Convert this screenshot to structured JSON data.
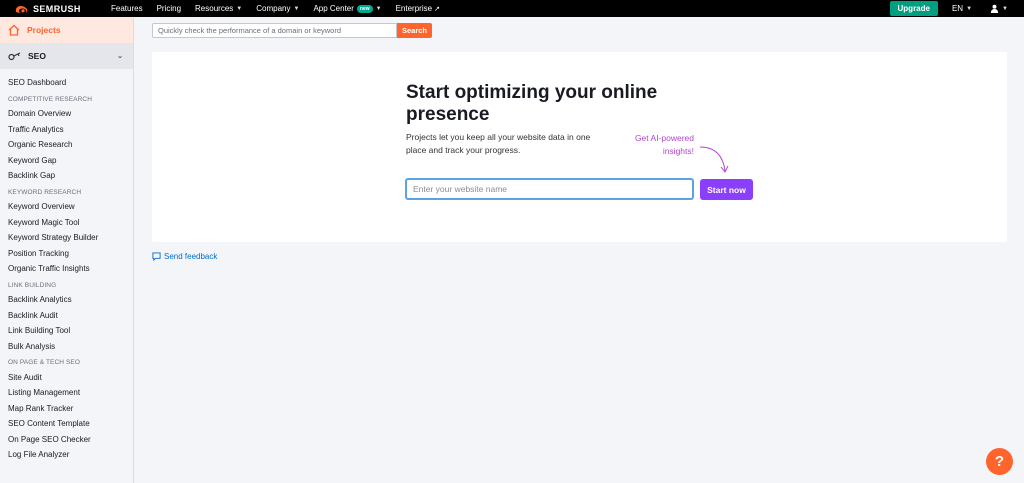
{
  "topbar": {
    "logo": "SEMRUSH",
    "nav": [
      {
        "label": "Features",
        "has_chevron": false
      },
      {
        "label": "Pricing",
        "has_chevron": false
      },
      {
        "label": "Resources",
        "has_chevron": true
      },
      {
        "label": "Company",
        "has_chevron": true
      },
      {
        "label": "App Center",
        "badge": "new",
        "has_chevron": true
      },
      {
        "label": "Enterprise",
        "external": true
      }
    ],
    "upgrade_label": "Upgrade",
    "language": "EN"
  },
  "sidebar": {
    "projects_label": "Projects",
    "seo_label": "SEO",
    "items": [
      {
        "type": "item",
        "label": "SEO Dashboard"
      },
      {
        "type": "head",
        "label": "COMPETITIVE RESEARCH"
      },
      {
        "type": "item",
        "label": "Domain Overview"
      },
      {
        "type": "item",
        "label": "Traffic Analytics"
      },
      {
        "type": "item",
        "label": "Organic Research"
      },
      {
        "type": "item",
        "label": "Keyword Gap"
      },
      {
        "type": "item",
        "label": "Backlink Gap"
      },
      {
        "type": "head",
        "label": "KEYWORD RESEARCH"
      },
      {
        "type": "item",
        "label": "Keyword Overview"
      },
      {
        "type": "item",
        "label": "Keyword Magic Tool"
      },
      {
        "type": "item",
        "label": "Keyword Strategy Builder"
      },
      {
        "type": "item",
        "label": "Position Tracking"
      },
      {
        "type": "item",
        "label": "Organic Traffic Insights"
      },
      {
        "type": "head",
        "label": "LINK BUILDING"
      },
      {
        "type": "item",
        "label": "Backlink Analytics"
      },
      {
        "type": "item",
        "label": "Backlink Audit"
      },
      {
        "type": "item",
        "label": "Link Building Tool"
      },
      {
        "type": "item",
        "label": "Bulk Analysis"
      },
      {
        "type": "head",
        "label": "ON PAGE & TECH SEO"
      },
      {
        "type": "item",
        "label": "Site Audit"
      },
      {
        "type": "item",
        "label": "Listing Management"
      },
      {
        "type": "item",
        "label": "Map Rank Tracker"
      },
      {
        "type": "item",
        "label": "SEO Content Template"
      },
      {
        "type": "item",
        "label": "On Page SEO Checker"
      },
      {
        "type": "item",
        "label": "Log File Analyzer"
      }
    ]
  },
  "search": {
    "placeholder": "Quickly check the performance of a domain or keyword",
    "button_label": "Search"
  },
  "main": {
    "headline": "Start optimizing your online presence",
    "description": "Projects let you keep all your website data in one place and track your progress.",
    "ai_note": "Get AI-powered insights!",
    "input_placeholder": "Enter your website name",
    "start_label": "Start now"
  },
  "feedback_label": "Send feedback",
  "help_label": "?",
  "colors": {
    "brand_orange": "#ff642d",
    "upgrade_green": "#009f81",
    "start_purple": "#8a3ffc",
    "ai_note": "#b046d0",
    "link_blue": "#006dca"
  }
}
